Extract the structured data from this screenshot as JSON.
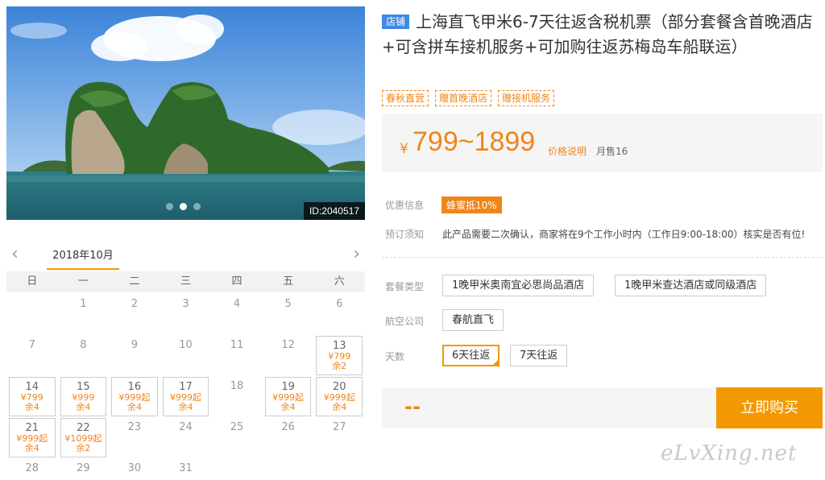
{
  "photo": {
    "id_label": "ID:2040517",
    "carousel_count": 3,
    "carousel_active": 1
  },
  "calendar": {
    "month_label": "2018年10月",
    "prev_icon": "chevron-left-icon",
    "next_icon": "chevron-right-icon",
    "weekdays": [
      "日",
      "一",
      "二",
      "三",
      "四",
      "五",
      "六"
    ],
    "leading_blanks": 1,
    "days": [
      {
        "d": "1"
      },
      {
        "d": "2"
      },
      {
        "d": "3"
      },
      {
        "d": "4"
      },
      {
        "d": "5"
      },
      {
        "d": "6"
      },
      {
        "d": "7"
      },
      {
        "d": "8"
      },
      {
        "d": "9"
      },
      {
        "d": "10"
      },
      {
        "d": "11"
      },
      {
        "d": "12"
      },
      {
        "d": "13",
        "price": "¥799",
        "stock": "余2"
      },
      {
        "d": "14",
        "price": "¥799",
        "stock": "余4"
      },
      {
        "d": "15",
        "price": "¥999",
        "stock": "余4"
      },
      {
        "d": "16",
        "price": "¥999起",
        "stock": "余4"
      },
      {
        "d": "17",
        "price": "¥999起",
        "stock": "余4"
      },
      {
        "d": "18"
      },
      {
        "d": "19",
        "price": "¥999起",
        "stock": "余4"
      },
      {
        "d": "20",
        "price": "¥999起",
        "stock": "余4"
      },
      {
        "d": "21",
        "price": "¥999起",
        "stock": "余4"
      },
      {
        "d": "22",
        "price": "¥1099起",
        "stock": "余2"
      },
      {
        "d": "23"
      },
      {
        "d": "24"
      },
      {
        "d": "25"
      },
      {
        "d": "26"
      },
      {
        "d": "27"
      },
      {
        "d": "28"
      },
      {
        "d": "29"
      },
      {
        "d": "30"
      },
      {
        "d": "31"
      }
    ]
  },
  "product": {
    "shop_badge": "店铺",
    "title": "上海直飞甲米6-7天往返含税机票（部分套餐含首晚酒店+可含拼车接机服务+可加购往返苏梅岛车船联运）",
    "tags": [
      "春秋直营",
      "赠首晚酒店",
      "赠接机服务"
    ],
    "price_symbol": "¥",
    "price_range": "799~1899",
    "price_note": "价格说明",
    "monthly_sales": "月售16"
  },
  "info": {
    "promo_label": "优惠信息",
    "promo_badge": "蜂蜜抵10%",
    "notice_label": "预订须知",
    "notice_text": "此产品需要二次确认，商家将在9个工作小时内（工作日9:00-18:00）核实是否有位!"
  },
  "options": {
    "package_label": "套餐类型",
    "packages": [
      "1晚甲米奥南宜必思尚品酒店",
      "1晚甲米查达酒店或同级酒店"
    ],
    "airline_label": "航空公司",
    "airlines": [
      "春航直飞"
    ],
    "days_label": "天数",
    "days": [
      "6天往返",
      "7天往返"
    ],
    "days_selected": 0
  },
  "buy": {
    "total": "--",
    "button_label": "立即购买"
  },
  "watermark": "eLvXing.net",
  "colors": {
    "accent": "#f39800",
    "price": "#f08519",
    "shop_badge": "#3e89e5"
  }
}
